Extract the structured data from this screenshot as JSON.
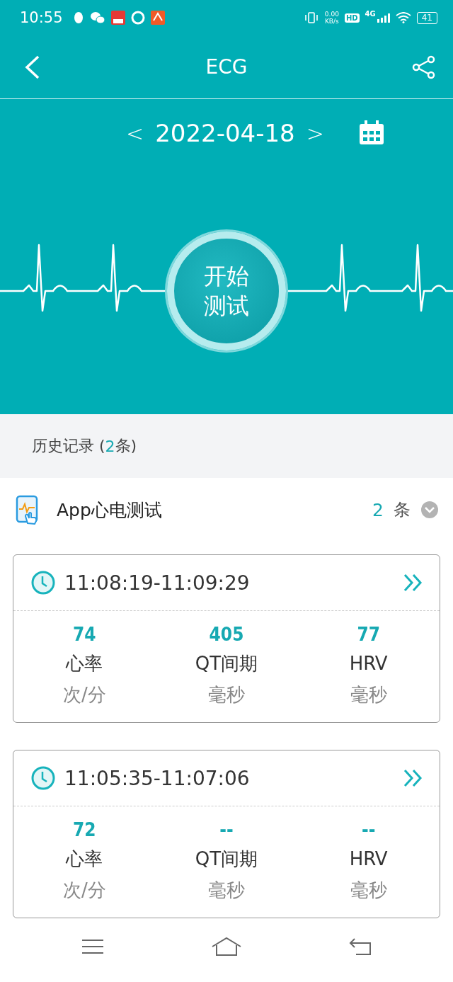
{
  "status_bar": {
    "time": "10:55",
    "net_speed": "0.00",
    "net_unit": "KB/s",
    "hd": "HD",
    "network": "4G",
    "battery": "41"
  },
  "header": {
    "title": "ECG"
  },
  "date_bar": {
    "prev": "<",
    "date": "2022-04-18",
    "next": ">"
  },
  "start_button": {
    "lines": [
      "开始",
      "测试"
    ]
  },
  "history": {
    "prefix": "历史记录 (",
    "count": "2",
    "suffix": "条)"
  },
  "group": {
    "title": "App心电测试",
    "count": "2",
    "unit": "条",
    "expanded": false
  },
  "records": [
    {
      "time": "11:08:19-11:09:29",
      "metrics": [
        {
          "value": "74",
          "label": "心率",
          "unit": "次/分"
        },
        {
          "value": "405",
          "label": "QT间期",
          "unit": "毫秒"
        },
        {
          "value": "77",
          "label": "HRV",
          "unit": "毫秒"
        }
      ]
    },
    {
      "time": "11:05:35-11:07:06",
      "metrics": [
        {
          "value": "72",
          "label": "心率",
          "unit": "次/分"
        },
        {
          "value": "--",
          "label": "QT间期",
          "unit": "毫秒"
        },
        {
          "value": "--",
          "label": "HRV",
          "unit": "毫秒"
        }
      ]
    }
  ]
}
